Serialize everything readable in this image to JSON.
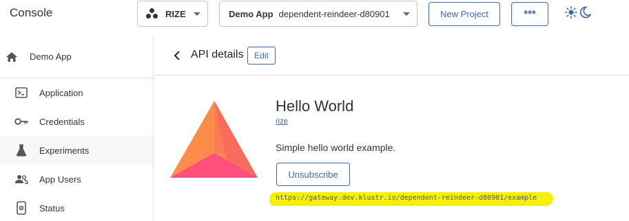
{
  "header": {
    "brand": "Console",
    "org_select": {
      "value": "RIZE",
      "icon": "org-logo-icon"
    },
    "app_select": {
      "app_name": "Demo App",
      "app_id": "dependent-reindeer-d80901"
    },
    "new_project_label": "New Project",
    "secrets_label": "***",
    "theme_icons": [
      "sun-icon",
      "moon-icon"
    ]
  },
  "sidebar": {
    "header": {
      "label": "Demo App",
      "icon": "home-icon"
    },
    "items": [
      {
        "label": "Application",
        "icon": "terminal-icon"
      },
      {
        "label": "Credentials",
        "icon": "key-icon"
      },
      {
        "label": "Experiments",
        "icon": "flask-icon"
      },
      {
        "label": "App Users",
        "icon": "users-icon"
      },
      {
        "label": "Status",
        "icon": "phone-settings-icon"
      }
    ]
  },
  "main": {
    "title": "API details",
    "edit_label": "Edit",
    "api": {
      "name": "Hello World",
      "owner": "rize",
      "description": "Simple hello world example.",
      "unsubscribe_label": "Unsubscribe",
      "endpoint": "https://gateway.dev.klustr.io/dependent-reindeer-d80901/example"
    }
  },
  "colors": {
    "accent": "#3f67b1",
    "highlight": "#f4f00a",
    "logo_orange": "#fb8c4a",
    "logo_pink": "#ff4f7b"
  }
}
